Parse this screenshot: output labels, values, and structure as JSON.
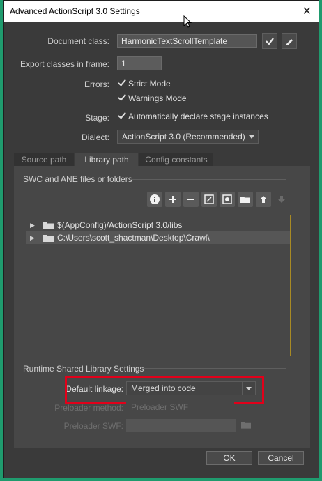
{
  "window": {
    "title": "Advanced ActionScript 3.0 Settings",
    "close_glyph": "✕"
  },
  "form": {
    "document_class_label": "Document class:",
    "document_class_value": "HarmonicTextScrollTemplate",
    "export_frame_label": "Export classes in frame:",
    "export_frame_value": "1",
    "errors_label": "Errors:",
    "strict_mode_label": "Strict Mode",
    "strict_mode_checked": true,
    "warnings_mode_label": "Warnings Mode",
    "warnings_mode_checked": true,
    "stage_label": "Stage:",
    "stage_auto_label": "Automatically declare stage instances",
    "stage_auto_checked": true,
    "dialect_label": "Dialect:",
    "dialect_value": "ActionScript 3.0 (Recommended)"
  },
  "tabs": [
    {
      "label": "Source path",
      "active": false
    },
    {
      "label": "Library path",
      "active": true
    },
    {
      "label": "Config constants",
      "active": false
    }
  ],
  "library": {
    "section_title": "SWC and ANE files or folders",
    "toolbar_icons": [
      "info-icon",
      "plus-icon",
      "minus-icon",
      "edit-icon",
      "swc-icon",
      "folder-icon",
      "arrow-up-icon",
      "arrow-down-icon"
    ],
    "paths": [
      "$(AppConfig)/ActionScript 3.0/libs",
      "C:\\Users\\scott_shactman\\Desktop\\Crawl\\"
    ]
  },
  "rsl": {
    "section_title": "Runtime Shared Library Settings",
    "default_linkage_label": "Default linkage:",
    "default_linkage_value": "Merged into code",
    "preloader_method_label": "Preloader method:",
    "preloader_method_value": "Preloader SWF",
    "preloader_swf_label": "Preloader SWF:",
    "preloader_swf_value": ""
  },
  "buttons": {
    "ok": "OK",
    "cancel": "Cancel"
  },
  "colors": {
    "highlight": "#e2001a",
    "tree_border": "#a88a24"
  }
}
